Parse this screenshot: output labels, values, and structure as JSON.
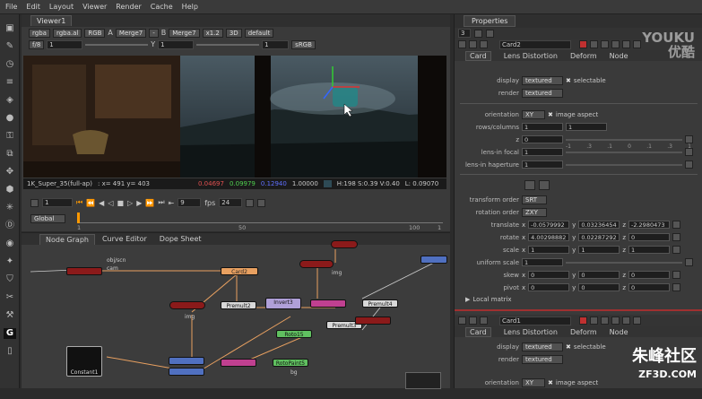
{
  "menubar": {
    "items": [
      "File",
      "Edit",
      "Layout",
      "Viewer",
      "Render",
      "Cache",
      "Help"
    ]
  },
  "viewer": {
    "tab": "Viewer1",
    "controls_row1": {
      "channels": "rgba",
      "alpha": "rgba.al",
      "display": "RGB",
      "a_label": "A",
      "a_input": "Merge7",
      "dash": "-",
      "b_label": "B",
      "b_input": "Merge7",
      "zoom": "x1.2",
      "view": "3D",
      "lut": "default"
    },
    "controls_row2": {
      "fstop": "f/8",
      "gain": "1",
      "y_label": "Y",
      "gamma": "1",
      "frame": "1",
      "colorspace": "sRGB"
    },
    "info_line": {
      "format": "1K_Super_35(full-ap)",
      "coords": ": x= 491 y= 403",
      "r": "0.04697",
      "g": "0.09979",
      "b": "0.12940",
      "a": "1.00000",
      "hsv": "H:198 S:0.39 V:0.40",
      "lum": "L: 0.09070"
    },
    "playbar": {
      "frame_field": "1",
      "increment": "9",
      "fps_label": "fps",
      "fps": "24",
      "range_mode": "Global",
      "ticks": [
        "1",
        "50",
        "100",
        "1"
      ]
    }
  },
  "nodegraph": {
    "tabs": [
      "Node Graph",
      "Curve Editor",
      "Dope Sheet"
    ],
    "nodes": [
      {
        "name": "Card2"
      },
      {
        "name": "Premult2"
      },
      {
        "name": "Invert3"
      },
      {
        "name": "Premult4"
      },
      {
        "name": "Premult3"
      },
      {
        "name": "Constant1"
      },
      {
        "name": "Roto15"
      },
      {
        "name": "RotoPaint5"
      },
      {
        "name": "cam"
      },
      {
        "name": "obj/scn"
      }
    ],
    "labels": {
      "img": "img",
      "bg": "bg"
    }
  },
  "properties": {
    "tab": "Properties",
    "count": "3",
    "card": {
      "name": "Card2",
      "tabs": [
        "Card",
        "Lens Distortion",
        "Deform",
        "Node"
      ],
      "display_label": "display",
      "display": "textured",
      "selectable": "selectable",
      "render_label": "render",
      "render": "textured",
      "orientation_label": "orientation",
      "orientation": "XY",
      "image_aspect": "image aspect",
      "rows_columns_label": "rows/columns",
      "rows": "1",
      "cols": "1",
      "z_label": "z",
      "z": "0",
      "lens_focal_label": "lens-in focal",
      "lens_focal": "1",
      "lens_haperture_label": "lens-in haperture",
      "lens_haperture": "1",
      "transform_order_label": "transform order",
      "transform_order": "SRT",
      "rotation_order_label": "rotation order",
      "rotation_order": "ZXY",
      "translate_label": "translate",
      "translate": {
        "x": "-0.0579992",
        "y": "0.03236454",
        "z": "-2.2980473"
      },
      "rotate_label": "rotate",
      "rotate": {
        "x": "4.00298882",
        "y": "0.02287292",
        "z": "0"
      },
      "scale_label": "scale",
      "scale": {
        "x": "1",
        "y": "1",
        "z": "1"
      },
      "uniform_scale_label": "uniform scale",
      "uniform_scale": "1",
      "skew_label": "skew",
      "skew": {
        "x": "0",
        "y": "0",
        "z": "0"
      },
      "pivot_label": "pivot",
      "pivot": {
        "x": "0",
        "y": "0",
        "z": "0"
      },
      "local_matrix": "Local matrix",
      "slider_ticks_z": [
        "-1",
        ".3",
        ".1",
        "0",
        ".1",
        ".3",
        "1"
      ]
    },
    "card2": {
      "name": "Card1",
      "tabs": [
        "Card",
        "Lens Distortion",
        "Deform",
        "Node"
      ],
      "display_label": "display",
      "display": "textured",
      "selectable": "selectable",
      "render_label": "render",
      "render": "textured",
      "orientation_label": "orientation",
      "orientation": "XY",
      "image_aspect": "image aspect"
    }
  },
  "watermarks": {
    "top": "YOUKU",
    "top2": "优酷",
    "bottom": "朱峰社区",
    "bottom2": "ZF3D.COM"
  },
  "colors": {
    "accent_red": "#c0392b",
    "node_red": "#8b1a1a",
    "node_orange": "#e8a060"
  }
}
